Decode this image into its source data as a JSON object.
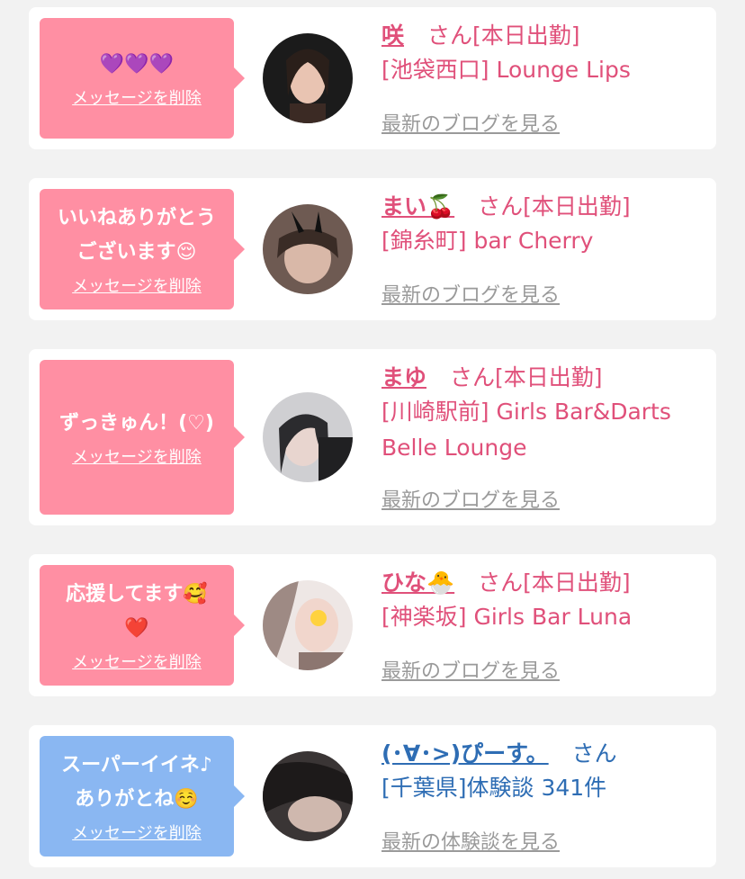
{
  "cards": [
    {
      "bubble_text": "💜💜💜",
      "delete_label": "メッセージを削除",
      "name": "咲",
      "suffix": "さん[本日出勤]",
      "shop": "[池袋西口] Lounge Lips",
      "link": "最新のブログを見る",
      "avatar_icon": "profile-photo"
    },
    {
      "bubble_text": "いいねありがとう\nございます😌",
      "delete_label": "メッセージを削除",
      "name": "まい🍒",
      "suffix": "さん[本日出勤]",
      "shop": "[錦糸町] bar Cherry",
      "link": "最新のブログを見る",
      "avatar_icon": "profile-photo"
    },
    {
      "bubble_text": "ずっきゅん！(♡)",
      "delete_label": "メッセージを削除",
      "name": "まゆ",
      "suffix": "さん[本日出勤]",
      "shop": "[川崎駅前] Girls Bar&Darts Belle Lounge",
      "link": "最新のブログを見る",
      "avatar_icon": "profile-photo"
    },
    {
      "bubble_text": "応援してます🥰\n❤️",
      "delete_label": "メッセージを削除",
      "name": "ひな🐣",
      "suffix": "さん[本日出勤]",
      "shop": "[神楽坂] Girls Bar Luna",
      "link": "最新のブログを見る",
      "avatar_icon": "profile-photo"
    },
    {
      "bubble_text": "スーパーイイネ♪\nありがとね☺️",
      "delete_label": "メッセージを削除",
      "name": "(･∀･>)ぴーす。",
      "suffix": "さん",
      "shop": "[千葉県]体験談 341件",
      "link": "最新の体験談を見る",
      "avatar_icon": "profile-photo"
    }
  ],
  "colors": {
    "card_bg": "#ffffff",
    "page_bg": "#f2f2f2",
    "pink_bubble": "#ff8fa3",
    "blue_bubble": "#8ab7f2",
    "pink_text": "#e0507a",
    "blue_text": "#2e6db4",
    "link_gray": "#9a9a9a"
  }
}
